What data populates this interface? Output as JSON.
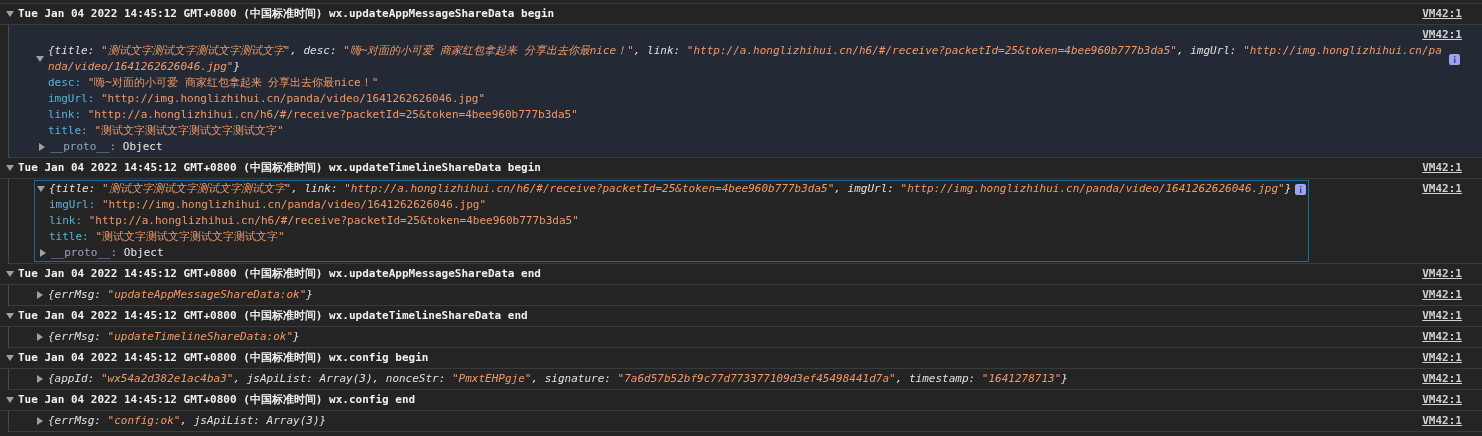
{
  "groups": [
    {
      "header": "Tue Jan 04 2022 14:45:12 GMT+0800 (中国标准时间) wx.updateAppMessageShareData begin",
      "source": "VM42:1",
      "expanded": true,
      "highlighted": true,
      "items": [
        {
          "source": "VM42:1",
          "expanded": true,
          "focused": false,
          "preview": [
            {
              "text": "{title: ",
              "kind": "key"
            },
            {
              "text": "\"测试文字测试文字测试文字测试文字\"",
              "kind": "string"
            },
            {
              "text": ", desc: ",
              "kind": "key"
            },
            {
              "text": "\"嗨~对面的小可爱 商家红包拿起来 分享出去你最nice！\"",
              "kind": "string"
            },
            {
              "text": ", link: ",
              "kind": "key"
            },
            {
              "text": "\"http://a.honglizhihui.cn/h6/#/receive?packetId=25&token=4bee960b777b3da5\"",
              "kind": "string"
            },
            {
              "text": ", imgUrl: ",
              "kind": "key"
            },
            {
              "text": "\"http://img.honglizhihui.cn/panda/video/1641262626046.jpg\"",
              "kind": "string"
            },
            {
              "text": "}",
              "kind": "key"
            }
          ],
          "properties": [
            {
              "key": "desc:",
              "value": "\"嗨~对面的小可爱 商家红包拿起来 分享出去你最nice！\"",
              "kind": "string"
            },
            {
              "key": "imgUrl:",
              "value": "\"http://img.honglizhihui.cn/panda/video/1641262626046.jpg\"",
              "kind": "string"
            },
            {
              "key": "link:",
              "value": "\"http://a.honglizhihui.cn/h6/#/receive?packetId=25&token=4bee960b777b3da5\"",
              "kind": "string"
            },
            {
              "key": "title:",
              "value": "\"测试文字测试文字测试文字测试文字\"",
              "kind": "string"
            }
          ],
          "proto": {
            "key": "__proto__:",
            "value": "Object"
          }
        }
      ]
    },
    {
      "header": "Tue Jan 04 2022 14:45:12 GMT+0800 (中国标准时间) wx.updateTimelineShareData begin",
      "source": "VM42:1",
      "expanded": true,
      "highlighted": false,
      "items": [
        {
          "source": "VM42:1",
          "expanded": true,
          "focused": true,
          "preview": [
            {
              "text": "{title: ",
              "kind": "key"
            },
            {
              "text": "\"测试文字测试文字测试文字测试文字\"",
              "kind": "string"
            },
            {
              "text": ", link: ",
              "kind": "key"
            },
            {
              "text": "\"http://a.honglizhihui.cn/h6/#/receive?packetId=25&token=4bee960b777b3da5\"",
              "kind": "string"
            },
            {
              "text": ", imgUrl: ",
              "kind": "key"
            },
            {
              "text": "\"http://img.honglizhihui.cn/panda/video/1641262626046.jpg\"",
              "kind": "string"
            },
            {
              "text": "}",
              "kind": "key"
            }
          ],
          "properties": [
            {
              "key": "imgUrl:",
              "value": "\"http://img.honglizhihui.cn/panda/video/1641262626046.jpg\"",
              "kind": "string"
            },
            {
              "key": "link:",
              "value": "\"http://a.honglizhihui.cn/h6/#/receive?packetId=25&token=4bee960b777b3da5\"",
              "kind": "string"
            },
            {
              "key": "title:",
              "value": "\"测试文字测试文字测试文字测试文字\"",
              "kind": "string"
            }
          ],
          "proto": {
            "key": "__proto__:",
            "value": "Object"
          }
        }
      ]
    },
    {
      "header": "Tue Jan 04 2022 14:45:12 GMT+0800 (中国标准时间) wx.updateAppMessageShareData end",
      "source": "VM42:1",
      "expanded": true,
      "highlighted": false,
      "items": [
        {
          "source": "VM42:1",
          "expanded": false,
          "focused": false,
          "preview": [
            {
              "text": "{errMsg: ",
              "kind": "key"
            },
            {
              "text": "\"updateAppMessageShareData:ok\"",
              "kind": "string"
            },
            {
              "text": "}",
              "kind": "key"
            }
          ]
        }
      ]
    },
    {
      "header": "Tue Jan 04 2022 14:45:12 GMT+0800 (中国标准时间) wx.updateTimelineShareData end",
      "source": "VM42:1",
      "expanded": true,
      "highlighted": false,
      "items": [
        {
          "source": "VM42:1",
          "expanded": false,
          "focused": false,
          "preview": [
            {
              "text": "{errMsg: ",
              "kind": "key"
            },
            {
              "text": "\"updateTimelineShareData:ok\"",
              "kind": "string"
            },
            {
              "text": "}",
              "kind": "key"
            }
          ]
        }
      ]
    },
    {
      "header": "Tue Jan 04 2022 14:45:12 GMT+0800 (中国标准时间) wx.config begin",
      "source": "VM42:1",
      "expanded": true,
      "highlighted": false,
      "items": [
        {
          "source": "VM42:1",
          "expanded": false,
          "focused": false,
          "preview": [
            {
              "text": "{appId: ",
              "kind": "key"
            },
            {
              "text": "\"wx54a2d382e1ac4ba3\"",
              "kind": "string"
            },
            {
              "text": ", jsApiList: Array(3), nonceStr: ",
              "kind": "key"
            },
            {
              "text": "\"PmxtEHPgje\"",
              "kind": "string"
            },
            {
              "text": ", signature: ",
              "kind": "key"
            },
            {
              "text": "\"7a6d57b52bf9c77d773377109d3ef45498441d7a\"",
              "kind": "string"
            },
            {
              "text": ", timestamp: ",
              "kind": "key"
            },
            {
              "text": "\"1641278713\"",
              "kind": "string"
            },
            {
              "text": "}",
              "kind": "key"
            }
          ]
        }
      ]
    },
    {
      "header": "Tue Jan 04 2022 14:45:12 GMT+0800 (中国标准时间) wx.config end",
      "source": "VM42:1",
      "expanded": true,
      "highlighted": false,
      "items": [
        {
          "source": "VM42:1",
          "expanded": false,
          "focused": false,
          "preview": [
            {
              "text": "{errMsg: ",
              "kind": "key"
            },
            {
              "text": "\"config:ok\"",
              "kind": "string"
            },
            {
              "text": ", jsApiList: Array(3)}",
              "kind": "key"
            }
          ]
        }
      ]
    }
  ]
}
